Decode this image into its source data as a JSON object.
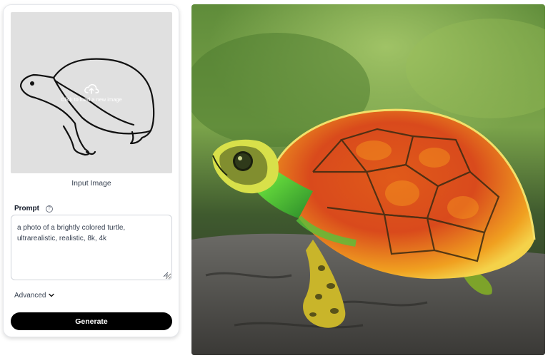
{
  "input_panel": {
    "upload_hint": "Click to load a new image",
    "upload_icon": "cloud-upload-icon",
    "caption": "Input Image"
  },
  "prompt": {
    "label": "Prompt",
    "help_icon": "question-circle-icon",
    "value": "a photo of a brightly colored turtle, ultrarealistic, realistic, 8k, 4k"
  },
  "advanced": {
    "label": "Advanced",
    "icon": "chevron-down-icon"
  },
  "actions": {
    "generate_label": "Generate"
  },
  "colors": {
    "button_bg": "#000000",
    "dropzone_bg": "#e0e0e0"
  }
}
